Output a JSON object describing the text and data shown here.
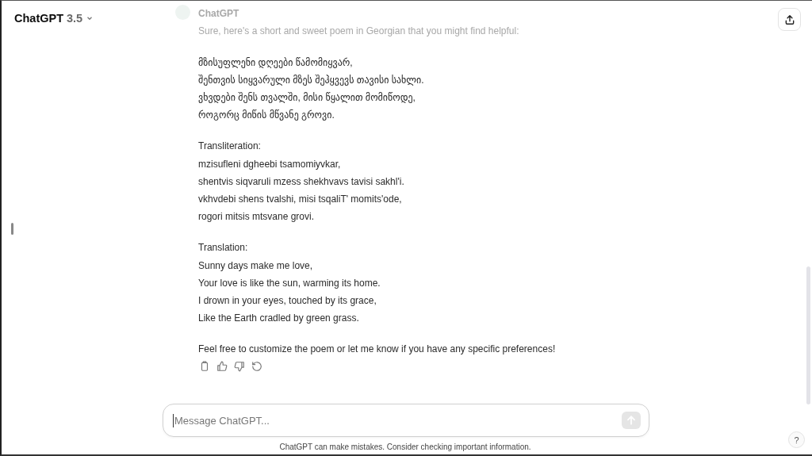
{
  "header": {
    "model_name": "ChatGPT",
    "model_version": "3.5"
  },
  "message": {
    "author": "ChatGPT",
    "intro": "Sure, here's a short and sweet poem in Georgian that you might find helpful:",
    "paragraphs": [
      {
        "lines": [
          "მზისუფლენი დღეები წამომიყვარ,",
          "შენთვის სიყვარული მზეს შეჰყვევს თავისი სახლი.",
          "ვხვდები შენს თვალში, მისი წყალით მომიწოდე,",
          "როგორც მიწის მწვანე გროვი."
        ]
      },
      {
        "lines": [
          "Transliteration:",
          "mzisufleni dgheebi tsamomiyvkar,",
          "shentvis siqvaruli mzess shekhvavs tavisi sakhl'i.",
          "vkhvdebi shens tvalshi, misi tsqaliT' momits'ode,",
          "rogori mitsis mtsvane grovi."
        ]
      },
      {
        "lines": [
          "Translation:",
          "Sunny days make me love,",
          "Your love is like the sun, warming its home.",
          "I drown in your eyes, touched by its grace,",
          "Like the Earth cradled by green grass."
        ]
      },
      {
        "lines": [
          "Feel free to customize the poem or let me know if you have any specific preferences!"
        ]
      }
    ]
  },
  "composer": {
    "placeholder": "Message ChatGPT..."
  },
  "disclaimer": "ChatGPT can make mistakes. Consider checking important information.",
  "help_label": "?"
}
